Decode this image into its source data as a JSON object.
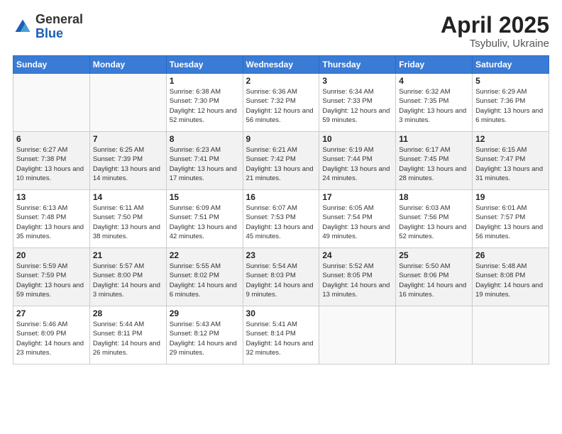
{
  "logo": {
    "general": "General",
    "blue": "Blue"
  },
  "title": {
    "month_year": "April 2025",
    "location": "Tsybuliv, Ukraine"
  },
  "days_of_week": [
    "Sunday",
    "Monday",
    "Tuesday",
    "Wednesday",
    "Thursday",
    "Friday",
    "Saturday"
  ],
  "weeks": [
    [
      {
        "day": null,
        "info": null
      },
      {
        "day": null,
        "info": null
      },
      {
        "day": "1",
        "info": "Sunrise: 6:38 AM\nSunset: 7:30 PM\nDaylight: 12 hours and 52 minutes."
      },
      {
        "day": "2",
        "info": "Sunrise: 6:36 AM\nSunset: 7:32 PM\nDaylight: 12 hours and 56 minutes."
      },
      {
        "day": "3",
        "info": "Sunrise: 6:34 AM\nSunset: 7:33 PM\nDaylight: 12 hours and 59 minutes."
      },
      {
        "day": "4",
        "info": "Sunrise: 6:32 AM\nSunset: 7:35 PM\nDaylight: 13 hours and 3 minutes."
      },
      {
        "day": "5",
        "info": "Sunrise: 6:29 AM\nSunset: 7:36 PM\nDaylight: 13 hours and 6 minutes."
      }
    ],
    [
      {
        "day": "6",
        "info": "Sunrise: 6:27 AM\nSunset: 7:38 PM\nDaylight: 13 hours and 10 minutes."
      },
      {
        "day": "7",
        "info": "Sunrise: 6:25 AM\nSunset: 7:39 PM\nDaylight: 13 hours and 14 minutes."
      },
      {
        "day": "8",
        "info": "Sunrise: 6:23 AM\nSunset: 7:41 PM\nDaylight: 13 hours and 17 minutes."
      },
      {
        "day": "9",
        "info": "Sunrise: 6:21 AM\nSunset: 7:42 PM\nDaylight: 13 hours and 21 minutes."
      },
      {
        "day": "10",
        "info": "Sunrise: 6:19 AM\nSunset: 7:44 PM\nDaylight: 13 hours and 24 minutes."
      },
      {
        "day": "11",
        "info": "Sunrise: 6:17 AM\nSunset: 7:45 PM\nDaylight: 13 hours and 28 minutes."
      },
      {
        "day": "12",
        "info": "Sunrise: 6:15 AM\nSunset: 7:47 PM\nDaylight: 13 hours and 31 minutes."
      }
    ],
    [
      {
        "day": "13",
        "info": "Sunrise: 6:13 AM\nSunset: 7:48 PM\nDaylight: 13 hours and 35 minutes."
      },
      {
        "day": "14",
        "info": "Sunrise: 6:11 AM\nSunset: 7:50 PM\nDaylight: 13 hours and 38 minutes."
      },
      {
        "day": "15",
        "info": "Sunrise: 6:09 AM\nSunset: 7:51 PM\nDaylight: 13 hours and 42 minutes."
      },
      {
        "day": "16",
        "info": "Sunrise: 6:07 AM\nSunset: 7:53 PM\nDaylight: 13 hours and 45 minutes."
      },
      {
        "day": "17",
        "info": "Sunrise: 6:05 AM\nSunset: 7:54 PM\nDaylight: 13 hours and 49 minutes."
      },
      {
        "day": "18",
        "info": "Sunrise: 6:03 AM\nSunset: 7:56 PM\nDaylight: 13 hours and 52 minutes."
      },
      {
        "day": "19",
        "info": "Sunrise: 6:01 AM\nSunset: 7:57 PM\nDaylight: 13 hours and 56 minutes."
      }
    ],
    [
      {
        "day": "20",
        "info": "Sunrise: 5:59 AM\nSunset: 7:59 PM\nDaylight: 13 hours and 59 minutes."
      },
      {
        "day": "21",
        "info": "Sunrise: 5:57 AM\nSunset: 8:00 PM\nDaylight: 14 hours and 3 minutes."
      },
      {
        "day": "22",
        "info": "Sunrise: 5:55 AM\nSunset: 8:02 PM\nDaylight: 14 hours and 6 minutes."
      },
      {
        "day": "23",
        "info": "Sunrise: 5:54 AM\nSunset: 8:03 PM\nDaylight: 14 hours and 9 minutes."
      },
      {
        "day": "24",
        "info": "Sunrise: 5:52 AM\nSunset: 8:05 PM\nDaylight: 14 hours and 13 minutes."
      },
      {
        "day": "25",
        "info": "Sunrise: 5:50 AM\nSunset: 8:06 PM\nDaylight: 14 hours and 16 minutes."
      },
      {
        "day": "26",
        "info": "Sunrise: 5:48 AM\nSunset: 8:08 PM\nDaylight: 14 hours and 19 minutes."
      }
    ],
    [
      {
        "day": "27",
        "info": "Sunrise: 5:46 AM\nSunset: 8:09 PM\nDaylight: 14 hours and 23 minutes."
      },
      {
        "day": "28",
        "info": "Sunrise: 5:44 AM\nSunset: 8:11 PM\nDaylight: 14 hours and 26 minutes."
      },
      {
        "day": "29",
        "info": "Sunrise: 5:43 AM\nSunset: 8:12 PM\nDaylight: 14 hours and 29 minutes."
      },
      {
        "day": "30",
        "info": "Sunrise: 5:41 AM\nSunset: 8:14 PM\nDaylight: 14 hours and 32 minutes."
      },
      {
        "day": null,
        "info": null
      },
      {
        "day": null,
        "info": null
      },
      {
        "day": null,
        "info": null
      }
    ]
  ]
}
